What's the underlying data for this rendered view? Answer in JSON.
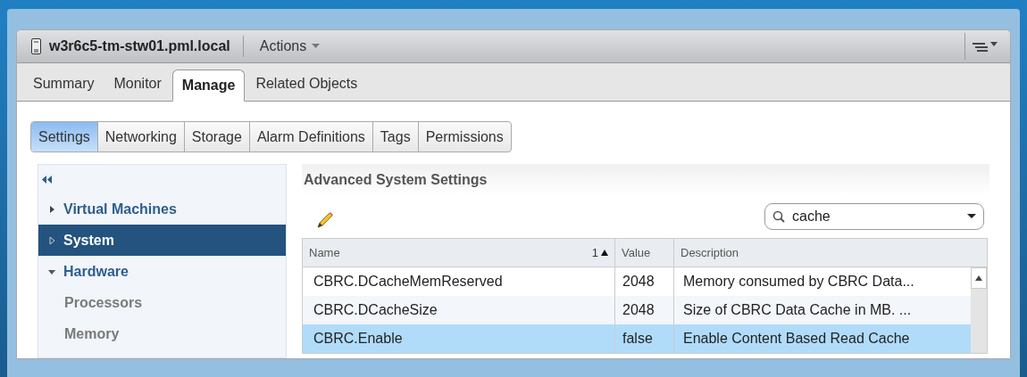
{
  "header": {
    "title": "w3r6c5-tm-stw01.pml.local",
    "actions_label": "Actions"
  },
  "tabs": [
    {
      "label": "Summary",
      "selected": false
    },
    {
      "label": "Monitor",
      "selected": false
    },
    {
      "label": "Manage",
      "selected": true
    },
    {
      "label": "Related Objects",
      "selected": false
    }
  ],
  "settings_tabs": [
    {
      "label": "Settings",
      "selected": true
    },
    {
      "label": "Networking",
      "selected": false
    },
    {
      "label": "Storage",
      "selected": false
    },
    {
      "label": "Alarm Definitions",
      "selected": false
    },
    {
      "label": "Tags",
      "selected": false
    },
    {
      "label": "Permissions",
      "selected": false
    }
  ],
  "sidebar": {
    "items": [
      {
        "label": "Virtual Machines",
        "expanded": false,
        "selected": false
      },
      {
        "label": "System",
        "expanded": false,
        "selected": true
      },
      {
        "label": "Hardware",
        "expanded": true,
        "selected": false,
        "children": [
          {
            "label": "Processors",
            "selected": false
          },
          {
            "label": "Memory",
            "selected": false
          }
        ]
      }
    ]
  },
  "panel": {
    "title": "Advanced System Settings",
    "search": {
      "value": "cache"
    }
  },
  "table": {
    "columns": [
      {
        "label": "Name",
        "sort_indicator": "1"
      },
      {
        "label": "Value"
      },
      {
        "label": "Description"
      }
    ],
    "rows": [
      {
        "name": "CBRC.DCacheMemReserved",
        "value": "2048",
        "description": "Memory consumed by CBRC Data...",
        "selected": false
      },
      {
        "name": "CBRC.DCacheSize",
        "value": "2048",
        "description": "Size of CBRC Data Cache in MB. ...",
        "selected": false
      },
      {
        "name": "CBRC.Enable",
        "value": "false",
        "description": "Enable Content Based Read Cache",
        "selected": true
      }
    ]
  }
}
